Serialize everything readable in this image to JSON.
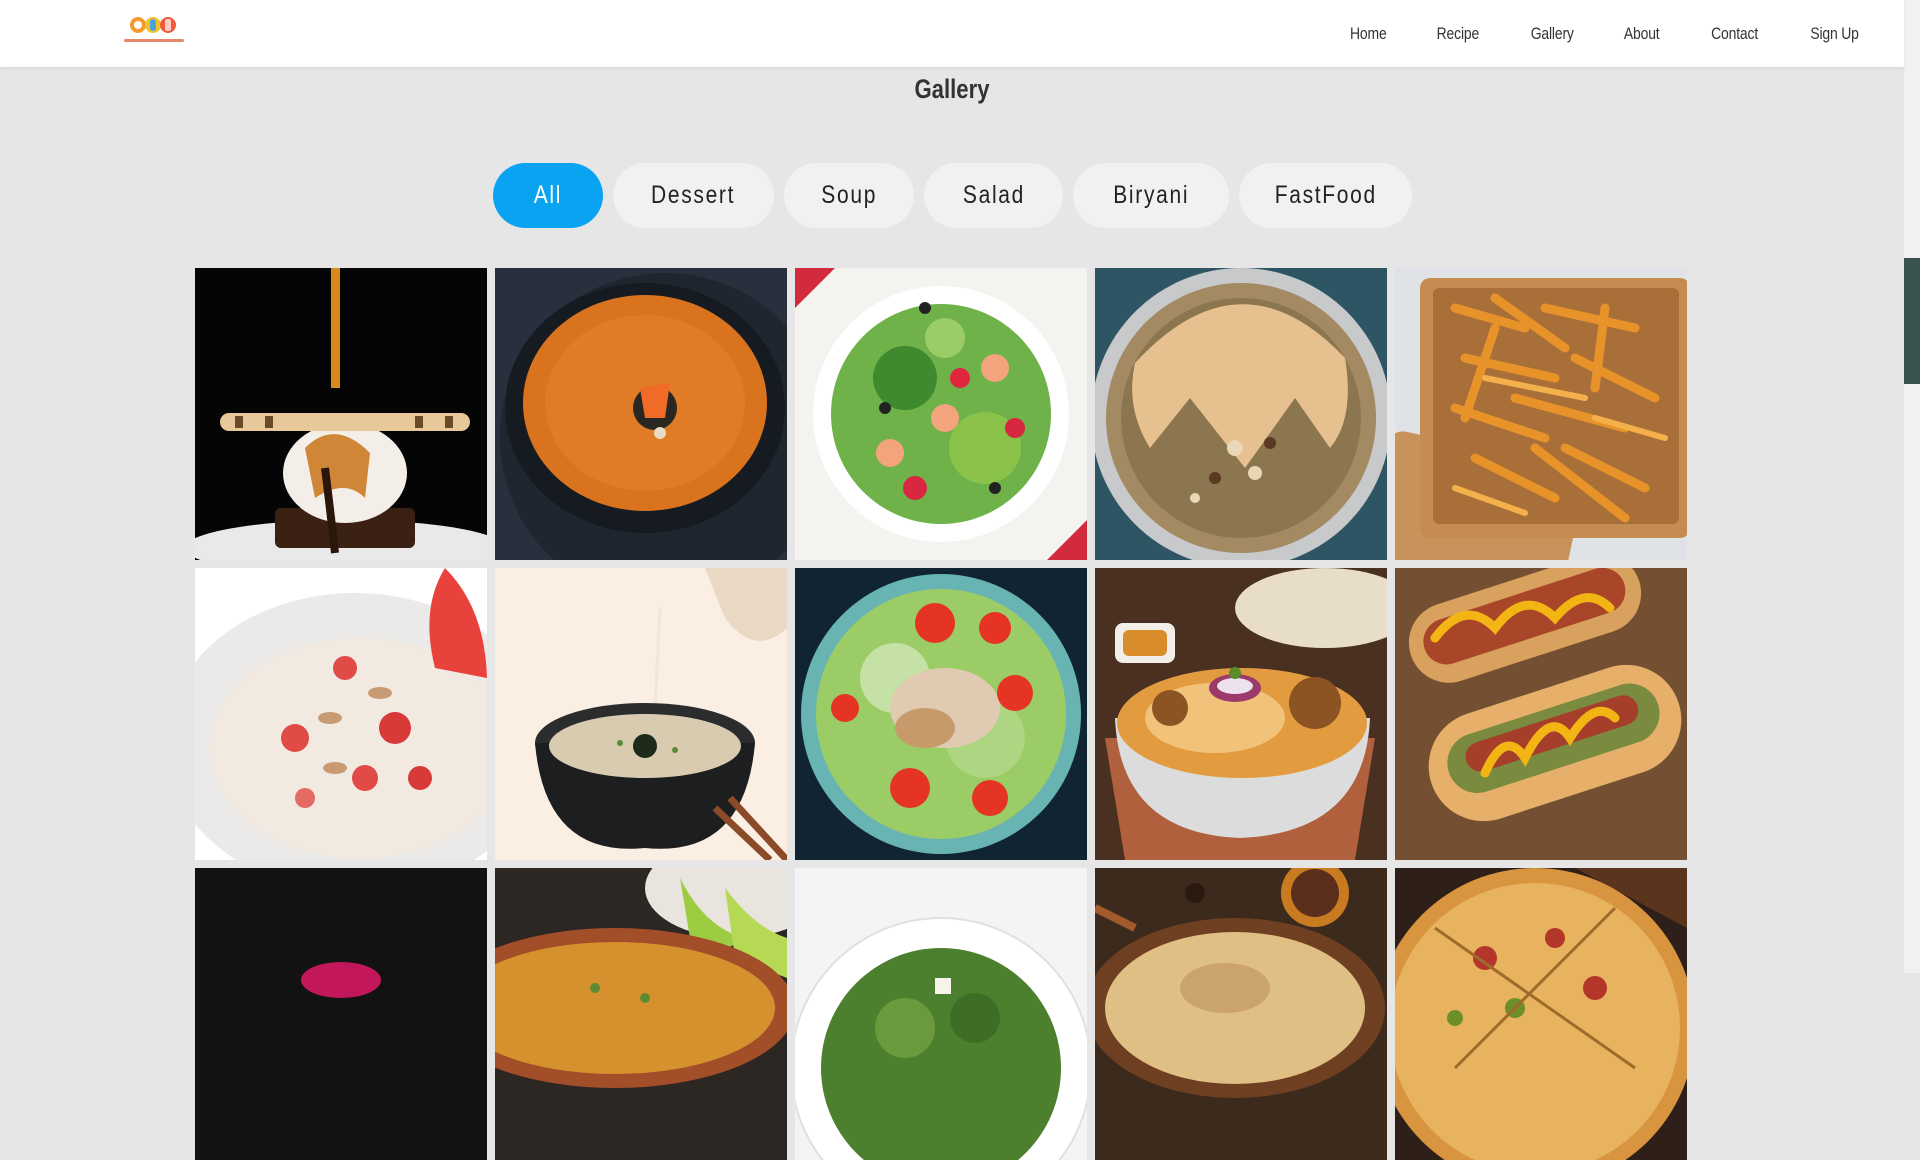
{
  "header": {
    "nav": [
      "Home",
      "Recipe",
      "Gallery",
      "About",
      "Contact",
      "Sign Up"
    ]
  },
  "page": {
    "title": "Gallery"
  },
  "filters": {
    "items": [
      "All",
      "Dessert",
      "Soup",
      "Salad",
      "Biryani",
      "FastFood"
    ],
    "active": "All"
  },
  "colors": {
    "accent": "#0aa3f2",
    "background": "#e6e6e6",
    "pill": "#f1f1f1",
    "scrollbar_thumb": "#3b5350"
  },
  "gallery": {
    "items": [
      {
        "category": "Dessert",
        "icon": "dessert-icecream-photo"
      },
      {
        "category": "Soup",
        "icon": "tomato-soup-photo"
      },
      {
        "category": "Salad",
        "icon": "shrimp-salad-photo"
      },
      {
        "category": "Biryani",
        "icon": "pot-biryani-photo"
      },
      {
        "category": "FastFood",
        "icon": "french-fries-photo"
      },
      {
        "category": "Dessert",
        "icon": "strawberry-oats-photo"
      },
      {
        "category": "Soup",
        "icon": "miso-soup-photo"
      },
      {
        "category": "Salad",
        "icon": "chicken-salad-photo"
      },
      {
        "category": "Biryani",
        "icon": "chicken-biryani-photo"
      },
      {
        "category": "FastFood",
        "icon": "hotdog-photo"
      },
      {
        "category": "Dessert",
        "icon": "dark-dessert-photo"
      },
      {
        "category": "Soup",
        "icon": "lime-soup-photo"
      },
      {
        "category": "Salad",
        "icon": "green-salad-photo"
      },
      {
        "category": "Biryani",
        "icon": "biryani-bowl-photo"
      },
      {
        "category": "FastFood",
        "icon": "pizza-photo"
      }
    ]
  }
}
